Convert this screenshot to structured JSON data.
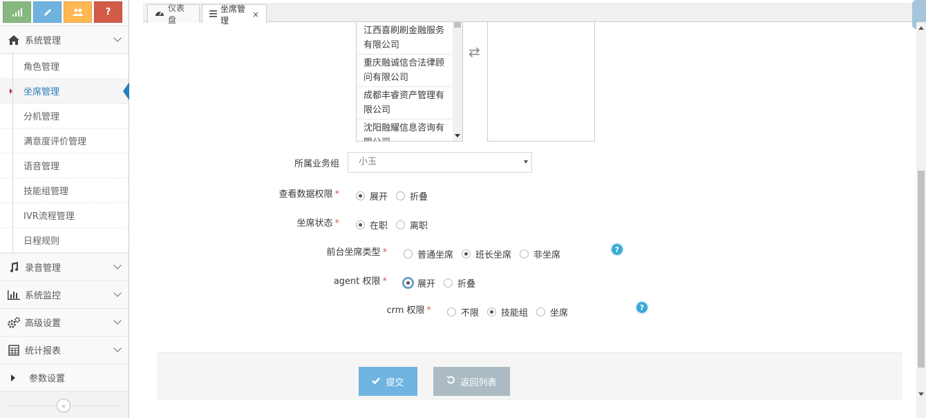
{
  "sidebar": {
    "shortcuts": [
      {
        "icon": "signal-icon",
        "color": "#87b87f"
      },
      {
        "icon": "pencil-icon",
        "color": "#6fb3e0"
      },
      {
        "icon": "users-icon",
        "color": "#ffb752"
      },
      {
        "icon": "help-icon",
        "label": "?",
        "color": "#d15b47"
      }
    ],
    "system_mgmt": "系统管理",
    "sub_items": [
      "角色管理",
      "坐席管理",
      "分机管理",
      "满意度评价管理",
      "语音管理",
      "技能组管理",
      "IVR流程管理",
      "日程规则"
    ],
    "recording": "录音管理",
    "monitor": "系统监控",
    "advanced": "高级设置",
    "reports": "统计报表",
    "params": "参数设置",
    "collapse_glyph": "«"
  },
  "tabs": {
    "dashboard": "仪表盘",
    "agent_mgmt": "坐席管理",
    "close": "×"
  },
  "dual_list": {
    "items": [
      "江西喜刷刷金融服务有限公司",
      "重庆融诚信合法律顾问有限公司",
      "成都丰睿资产管理有限公司",
      "沈阳融耀信息咨询有限公司"
    ],
    "swap_glyph": "⇄"
  },
  "form": {
    "business_group": {
      "label": "所属业务组",
      "value": "小玉"
    },
    "view_permission": {
      "label": "查看数据权限",
      "options": [
        "展开",
        "折叠"
      ],
      "selected": "展开"
    },
    "agent_status": {
      "label": "坐席状态",
      "options": [
        "在职",
        "离职"
      ],
      "selected": "在职"
    },
    "front_type": {
      "label": "前台坐席类型",
      "options": [
        "普通坐席",
        "班长坐席",
        "非坐席"
      ],
      "selected": "班长坐席"
    },
    "agent_permission": {
      "label": "agent 权限",
      "options": [
        "展开",
        "折叠"
      ],
      "selected": "展开"
    },
    "crm_permission": {
      "label": "crm 权限",
      "options": [
        "不限",
        "技能组",
        "坐席"
      ],
      "selected": "技能组"
    },
    "required_mark": "*",
    "help_glyph": "?"
  },
  "actions": {
    "submit": "提交",
    "back": "返回列表",
    "submit_color": "#6fb3e0",
    "back_color": "#abbac3"
  }
}
